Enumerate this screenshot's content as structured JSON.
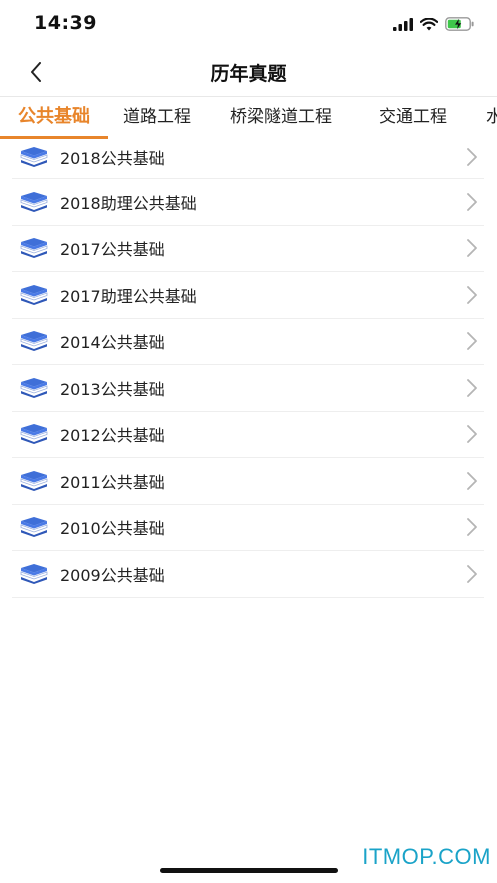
{
  "status_bar": {
    "time": "14:39",
    "icons": [
      "signal-icon",
      "wifi-icon",
      "battery-charging-icon"
    ]
  },
  "nav": {
    "title": "历年真题",
    "back_icon": "chevron-left-icon"
  },
  "tabs": [
    {
      "label": "公共基础",
      "active": true
    },
    {
      "label": "道路工程",
      "active": false
    },
    {
      "label": "桥梁隧道工程",
      "active": false
    },
    {
      "label": "交通工程",
      "active": false
    },
    {
      "label": "水",
      "active": false
    }
  ],
  "list": {
    "item_icon": "book-stack-icon",
    "arrow_icon": "chevron-right-icon",
    "items": [
      {
        "label": "2018公共基础"
      },
      {
        "label": "2018助理公共基础"
      },
      {
        "label": "2017公共基础"
      },
      {
        "label": "2017助理公共基础"
      },
      {
        "label": "2014公共基础"
      },
      {
        "label": "2013公共基础"
      },
      {
        "label": "2012公共基础"
      },
      {
        "label": "2011公共基础"
      },
      {
        "label": "2010公共基础"
      },
      {
        "label": "2009公共基础"
      }
    ]
  },
  "watermark": "ITMOP.COM",
  "colors": {
    "accent": "#e8852b",
    "book_blue": "#3f6fd8",
    "watermark": "#1aa3c8"
  }
}
